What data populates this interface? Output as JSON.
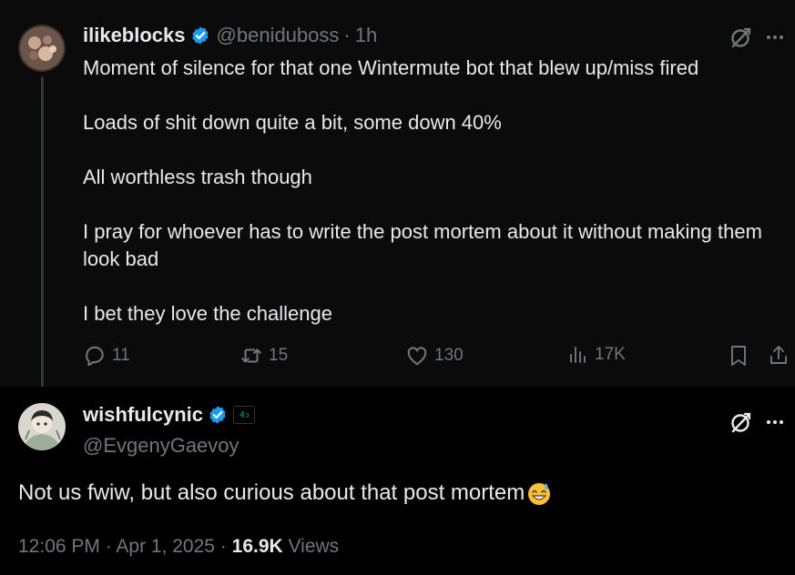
{
  "parent_tweet": {
    "display_name": "ilikeblocks",
    "handle": "@beniduboss",
    "separator": "·",
    "time_ago": "1h",
    "paragraphs": [
      "Moment of silence for that one Wintermute bot that blew up/miss fired",
      "Loads of shit down quite a bit, some down 40%",
      "All worthless trash though",
      "I pray for whoever has to write the post mortem about it without making them look bad",
      "I bet they love the challenge"
    ],
    "actions": {
      "replies": "11",
      "reposts": "15",
      "likes": "130",
      "views": "17K"
    }
  },
  "reply_tweet": {
    "display_name": "wishfulcynic",
    "handle": "@EvgenyGaevoy",
    "affiliation_badge": "4ↄ",
    "text": "Not us fwiw, but also curious about that post mortem",
    "timestamp": "12:06 PM · Apr 1, 2025 · ",
    "views_count": "16.9K",
    "views_label": " Views"
  },
  "colors": {
    "background": "#000000",
    "parent_background": "#0b0b0c",
    "text_primary": "#e7e9ea",
    "text_secondary": "#71767b",
    "verified_blue": "#1d9bf0"
  },
  "icons": [
    "verified-badge-icon",
    "grok-icon",
    "more-icon",
    "reply-icon",
    "repost-icon",
    "like-icon",
    "views-icon",
    "bookmark-icon",
    "share-icon",
    "sweat-smile-emoji"
  ]
}
